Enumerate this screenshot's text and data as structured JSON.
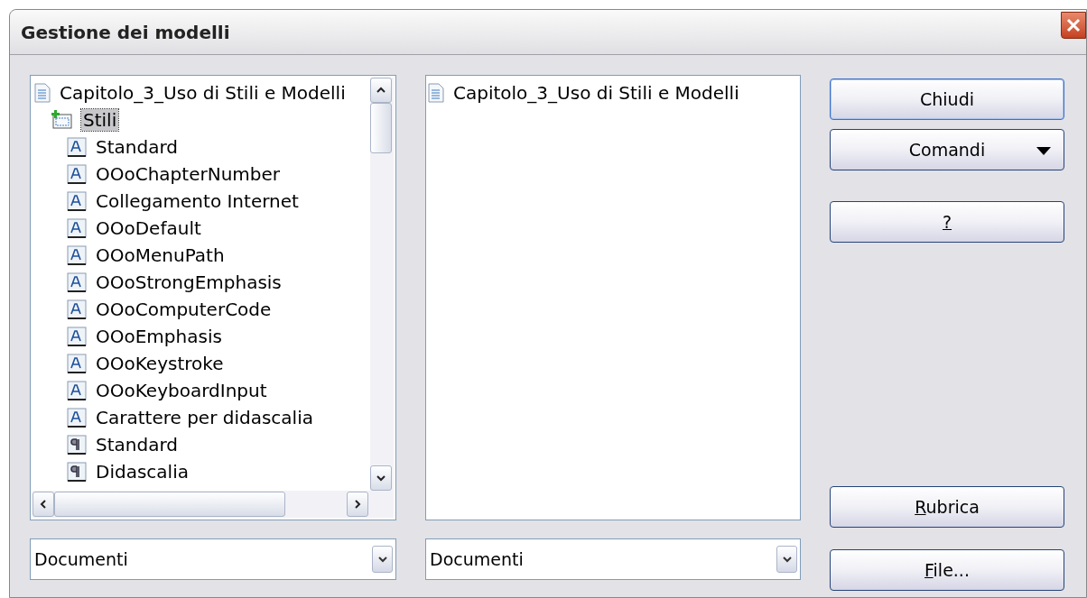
{
  "window": {
    "title": "Gestione dei modelli"
  },
  "left_list": {
    "tree": [
      {
        "label": "Capitolo_3_Uso di Stili e Modelli",
        "kind": "document",
        "selected": false,
        "children": [
          {
            "label": "Stili",
            "kind": "folder",
            "selected": true,
            "children": [
              {
                "label": "Standard",
                "kind": "character",
                "selected": false
              },
              {
                "label": "OOoChapterNumber",
                "kind": "character",
                "selected": false
              },
              {
                "label": "Collegamento Internet",
                "kind": "character",
                "selected": false
              },
              {
                "label": "OOoDefault",
                "kind": "character",
                "selected": false
              },
              {
                "label": "OOoMenuPath",
                "kind": "character",
                "selected": false
              },
              {
                "label": "OOoStrongEmphasis",
                "kind": "character",
                "selected": false
              },
              {
                "label": "OOoComputerCode",
                "kind": "character",
                "selected": false
              },
              {
                "label": "OOoEmphasis",
                "kind": "character",
                "selected": false
              },
              {
                "label": "OOoKeystroke",
                "kind": "character",
                "selected": false
              },
              {
                "label": "OOoKeyboardInput",
                "kind": "character",
                "selected": false
              },
              {
                "label": "Carattere per didascalia",
                "kind": "character",
                "selected": false
              },
              {
                "label": "Standard",
                "kind": "paragraph",
                "selected": false
              },
              {
                "label": "Didascalia",
                "kind": "paragraph",
                "selected": false
              }
            ]
          }
        ]
      }
    ],
    "dropdown": {
      "value": "Documenti"
    }
  },
  "right_list": {
    "tree": [
      {
        "label": "Capitolo_3_Uso di Stili e Modelli",
        "kind": "document",
        "selected": false
      }
    ],
    "dropdown": {
      "value": "Documenti"
    }
  },
  "buttons": [
    {
      "rest": "Chiudi",
      "kind": "default"
    },
    {
      "rest": "Comandi",
      "kind": "menu"
    },
    {
      "accel": "?",
      "kind": "plain"
    },
    {
      "accel": "R",
      "rest": "ubrica",
      "kind": "plain"
    },
    {
      "accel": "F",
      "rest": "ile...",
      "kind": "plain"
    }
  ]
}
